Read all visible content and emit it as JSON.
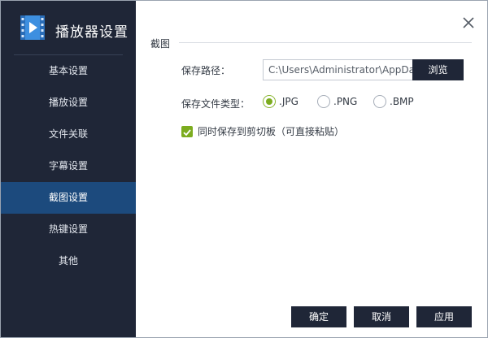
{
  "app": {
    "title": "播放器设置"
  },
  "sidebar": {
    "items": [
      {
        "label": "基本设置"
      },
      {
        "label": "播放设置"
      },
      {
        "label": "文件关联"
      },
      {
        "label": "字幕设置"
      },
      {
        "label": "截图设置",
        "active": true
      },
      {
        "label": "热键设置"
      },
      {
        "label": "其他"
      }
    ]
  },
  "section": {
    "title": "截图"
  },
  "save_path": {
    "label": "保存路径：",
    "value": "C:\\Users\\Administrator\\AppData",
    "browse_label": "浏览"
  },
  "file_type": {
    "label": "保存文件类型：",
    "options": [
      ".JPG",
      ".PNG",
      ".BMP"
    ],
    "selected": ".JPG"
  },
  "clipboard": {
    "label": "同时保存到剪切板（可直接粘贴）",
    "checked": true
  },
  "footer": {
    "ok_label": "确定",
    "cancel_label": "取消",
    "apply_label": "应用"
  },
  "colors": {
    "sidebar_bg": "#1f2637",
    "active_item": "#1c4a7d",
    "accent_green": "#7cac1f",
    "button_bg": "#1f2637"
  },
  "icons": {
    "logo": "video-player-logo-icon",
    "close": "close-icon",
    "check": "checkmark-icon"
  }
}
